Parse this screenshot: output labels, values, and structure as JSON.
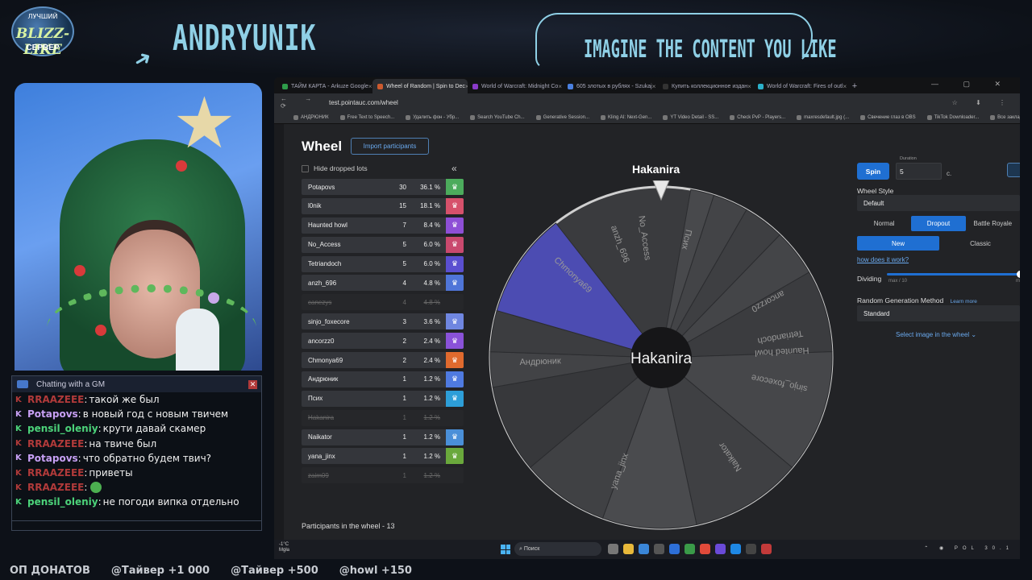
{
  "overlay": {
    "logo_top": "ЛУЧШИЙ",
    "logo_brand": "BLIZZ-LIKE",
    "logo_sub": "СЕРВЕР",
    "streamer_name": "ANDRYUNIK",
    "banner": "IMAGINE THE CONTENT YOU LIKE"
  },
  "chat": {
    "title": "Chatting with a GM",
    "close": "✕",
    "messages": [
      {
        "user": "RRAAZEEE",
        "text": "такой же был",
        "color": "#b13a3a"
      },
      {
        "user": "Potapovs",
        "text": "в новый год с новым твичем",
        "color": "#c7a0f4"
      },
      {
        "user": "pensil_oleniy",
        "text": "крути давай скамер",
        "color": "#4cd37a"
      },
      {
        "user": "RRAAZEEE",
        "text": "на твиче был",
        "color": "#b13a3a"
      },
      {
        "user": "Potapovs",
        "text": "что обратно будем твич?",
        "color": "#c7a0f4"
      },
      {
        "user": "RRAAZEEE",
        "text": "приветы",
        "color": "#b13a3a"
      },
      {
        "user": "RRAAZEEE",
        "text": "",
        "color": "#b13a3a",
        "emote": true
      },
      {
        "user": "pensil_oleniy",
        "text": "не погоди випка отдельно",
        "color": "#4cd37a"
      }
    ]
  },
  "ticker": [
    "ОП ДОНАТОВ",
    "@Тайвер +1 000",
    "@Тайвер +500",
    "@howl +150"
  ],
  "browser": {
    "tabs": [
      {
        "label": "ТАЙМ КАРТА - Arkuze Google",
        "color": "#2e9c4a",
        "active": false
      },
      {
        "label": "Wheel of Random | Spin to Dec",
        "color": "#cc5a2e",
        "active": true
      },
      {
        "label": "World of Warcraft: Midnight Co",
        "color": "#8a3ac9",
        "active": false
      },
      {
        "label": "605 злотых в рублях - Szukaj",
        "color": "#4a80e0",
        "active": false
      },
      {
        "label": "Купить коллекционное издан",
        "color": "#333",
        "active": false
      },
      {
        "label": "World of Warcraft: Fires of outl",
        "color": "#2bb0c9",
        "active": false
      }
    ],
    "new_tab": "+",
    "window_controls": "— ▢ ✕",
    "nav_icons": "← → ⟳",
    "url": "test.pointauc.com/wheel",
    "extensions": "☆ ⬇ ⋮",
    "bookmarks": [
      "АНДРЮНИК",
      "Free Text to Speech...",
      "Удалить фон - Убр...",
      "Search YouTube Ch...",
      "Generative Session...",
      "Kling AI: Next-Gen...",
      "YT Video Detail - SS...",
      "Check PvP - Players...",
      "maxresdefault.jpg (...",
      "Свечение глаз в OBS",
      "TikTok Downloader...",
      "Все закладки"
    ]
  },
  "page": {
    "title": "Wheel",
    "import_label": "Import participants",
    "hide_label": "Hide dropped lots",
    "collapse_label": "«",
    "lots": [
      {
        "name": "Potapovs",
        "amount": "30",
        "percent": "36.1 %",
        "color": "#4cab5c",
        "dropped": false
      },
      {
        "name": "l0nik",
        "amount": "15",
        "percent": "18.1 %",
        "color": "#d6516b",
        "dropped": false
      },
      {
        "name": "Haunted howl",
        "amount": "7",
        "percent": "8.4 %",
        "color": "#8e4fd6",
        "dropped": false
      },
      {
        "name": "No_Access",
        "amount": "5",
        "percent": "6.0 %",
        "color": "#c9496e",
        "dropped": false
      },
      {
        "name": "Tetriandoch",
        "amount": "5",
        "percent": "6.0 %",
        "color": "#5a4fd0",
        "dropped": false
      },
      {
        "name": "anzh_696",
        "amount": "4",
        "percent": "4.8 %",
        "color": "#4f75d8",
        "dropped": false
      },
      {
        "name": "canezys",
        "amount": "4",
        "percent": "4.8 %",
        "color": "#444",
        "dropped": true
      },
      {
        "name": "sinjo_foxecore",
        "amount": "3",
        "percent": "3.6 %",
        "color": "#6f86e0",
        "dropped": false
      },
      {
        "name": "ancorzz0",
        "amount": "2",
        "percent": "2.4 %",
        "color": "#8a52d8",
        "dropped": false
      },
      {
        "name": "Chmonya69",
        "amount": "2",
        "percent": "2.4 %",
        "color": "#e06a2e",
        "dropped": false
      },
      {
        "name": "Андрюник",
        "amount": "1",
        "percent": "1.2 %",
        "color": "#4f7ae0",
        "dropped": false
      },
      {
        "name": "Псих",
        "amount": "1",
        "percent": "1.2 %",
        "color": "#2d9ed8",
        "dropped": false
      },
      {
        "name": "Hakanira",
        "amount": "1",
        "percent": "1.2 %",
        "color": "#444",
        "dropped": true
      },
      {
        "name": "Naikator",
        "amount": "1",
        "percent": "1.2 %",
        "color": "#4a8fd8",
        "dropped": false
      },
      {
        "name": "yana_jinx",
        "amount": "1",
        "percent": "1.2 %",
        "color": "#6aa83c",
        "dropped": false
      },
      {
        "name": "zaim09",
        "amount": "1",
        "percent": "1.2 %",
        "color": "#444",
        "dropped": true
      }
    ],
    "lot_icon": "♛",
    "participants_label": "Participants in the wheel - 13",
    "winner": "Hakanira",
    "wheel_center": "Hakanira",
    "wheel_labels": [
      {
        "text": "Tetriandoch",
        "angle": 80
      },
      {
        "text": "Haunted howl",
        "angle": 87
      },
      {
        "text": "sinjo_foxecore",
        "angle": 102
      },
      {
        "text": "Naikator",
        "angle": 145
      },
      {
        "text": "yana_jinx",
        "angle": 200
      },
      {
        "text": "Андрюник",
        "angle": 268
      },
      {
        "text": "Chmonya69",
        "angle": 313
      },
      {
        "text": "anzh_696",
        "angle": 340
      },
      {
        "text": "No_Access",
        "angle": 352
      },
      {
        "text": "Псих",
        "angle": 12
      },
      {
        "text": "ancorzz0",
        "angle": 62
      }
    ]
  },
  "panel": {
    "spin_label": "Spin",
    "duration_label": "Duration",
    "duration_value": "5",
    "duration_unit": "с.",
    "style_label": "Wheel Style",
    "style_value": "Default",
    "modes": [
      "Normal",
      "Dropout",
      "Battle Royale"
    ],
    "active_mode": "Dropout",
    "dropout_types": [
      "New",
      "Classic"
    ],
    "active_dropout": "New",
    "how_link": "how does it work?",
    "dividing_label": "Dividing",
    "slider_min": "max / 10",
    "slider_max": "max",
    "slider_value": 1.0,
    "rng_label": "Random Generation Method",
    "learn_more": "Learn more",
    "rng_value": "Standard",
    "select_image": "Select image in the wheel ⌄"
  },
  "taskbar": {
    "weather_temp": "-1°C",
    "weather_desc": "Mgła",
    "search_placeholder": "Поиск",
    "tray": "⌃ ◉ POL 30.1"
  }
}
